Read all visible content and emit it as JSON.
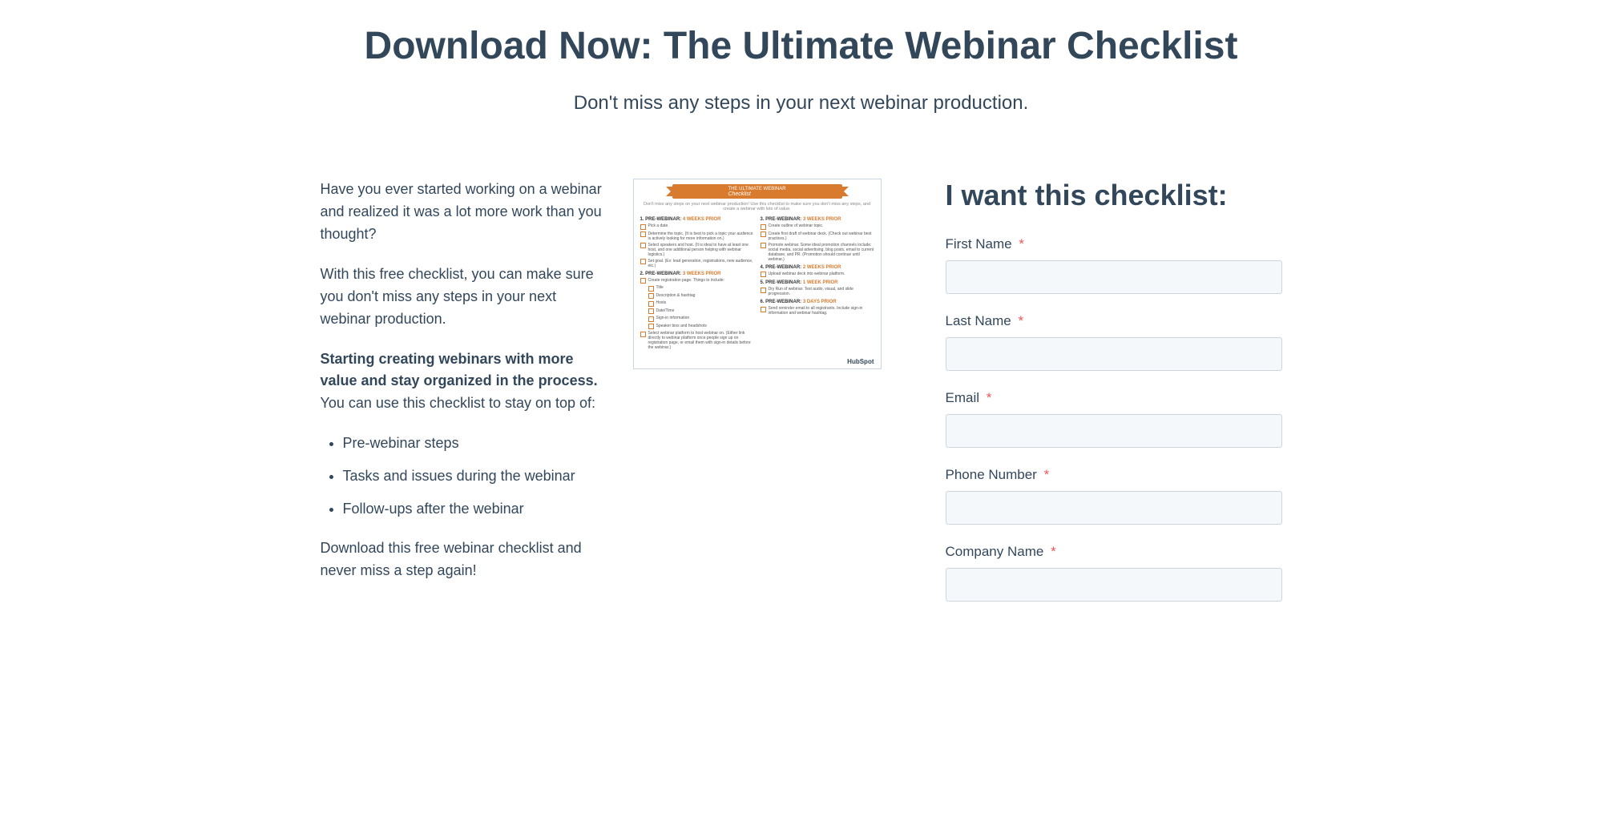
{
  "hero": {
    "title": "Download Now: The Ultimate Webinar Checklist",
    "subtitle": "Don't miss any steps in your next webinar production."
  },
  "desc": {
    "p1": "Have you ever started working on a webinar and realized it was a lot more work than you thought?",
    "p2": "With this free checklist, you can make sure you don't miss any steps in your next webinar production.",
    "p3_strong": "Starting creating webinars with more value and stay organized in the process.",
    "p3_rest": " You can use this checklist to stay on top of:",
    "bullets": [
      "Pre-webinar steps",
      "Tasks and issues during the webinar",
      "Follow-ups after the webinar"
    ],
    "closing": "Download this free webinar checklist and never miss a step again!"
  },
  "thumb": {
    "ribbon_top": "THE ULTIMATE WEBINAR",
    "ribbon_bottom": "Checklist",
    "subtitle": "Don't miss any steps on your next webinar production! Use this checklist to make sure you don't miss any steps, and create a webinar with lots of value.",
    "brand": "HubSpot",
    "left": [
      {
        "h": "1. PRE-WEBINAR:",
        "t": "4 WEEKS PRIOR",
        "items": [
          "Pick a date.",
          "Determine the topic. (It is best to pick a topic your audience is actively looking for more information on.)",
          "Select speakers and host. (It is ideal to have at least one host, and one additional person helping with webinar logistics.)",
          "Set goal. (Ex: lead generation, registrations, new audience, etc.)"
        ]
      },
      {
        "h": "2. PRE-WEBINAR:",
        "t": "3 WEEKS PRIOR",
        "items": [
          "Create registration page. Things to include:",
          "  Title",
          "  Description & hashtag",
          "  Hosts",
          "  Date/Time",
          "  Sign-in information",
          "  Speaker bios and headshots",
          "Select webinar platform to host webinar on. (Either link directly to webinar platform once people sign up on registration page, or email them with sign-in details before the webinar.)"
        ]
      }
    ],
    "right": [
      {
        "h": "3. PRE-WEBINAR:",
        "t": "3 WEEKS PRIOR",
        "items": [
          "Create outline of webinar topic.",
          "Create first draft of webinar deck. (Check out webinar best practices.)",
          "Promote webinar. Some ideal promotion channels include: social media, social advertising, blog posts, email to current database, and PR. (Promotion should continue until webinar.)"
        ]
      },
      {
        "h": "4. PRE-WEBINAR:",
        "t": "2 WEEKS PRIOR",
        "items": [
          "Upload webinar deck into webinar platform."
        ]
      },
      {
        "h": "5. PRE-WEBINAR:",
        "t": "1 WEEK PRIOR",
        "items": [
          "Dry Run of webinar. Test audio, visual, and slide progression."
        ]
      },
      {
        "h": "6. PRE-WEBINAR:",
        "t": "3 DAYS PRIOR",
        "items": [
          "Send reminder email to all registrants. Include sign-in information and webinar hashtag."
        ]
      }
    ]
  },
  "form": {
    "title": "I want this checklist:",
    "fields": [
      {
        "label": "First Name",
        "required": true
      },
      {
        "label": "Last Name",
        "required": true
      },
      {
        "label": "Email",
        "required": true
      },
      {
        "label": "Phone Number",
        "required": true
      },
      {
        "label": "Company Name",
        "required": true
      }
    ],
    "required_mark": "*"
  }
}
